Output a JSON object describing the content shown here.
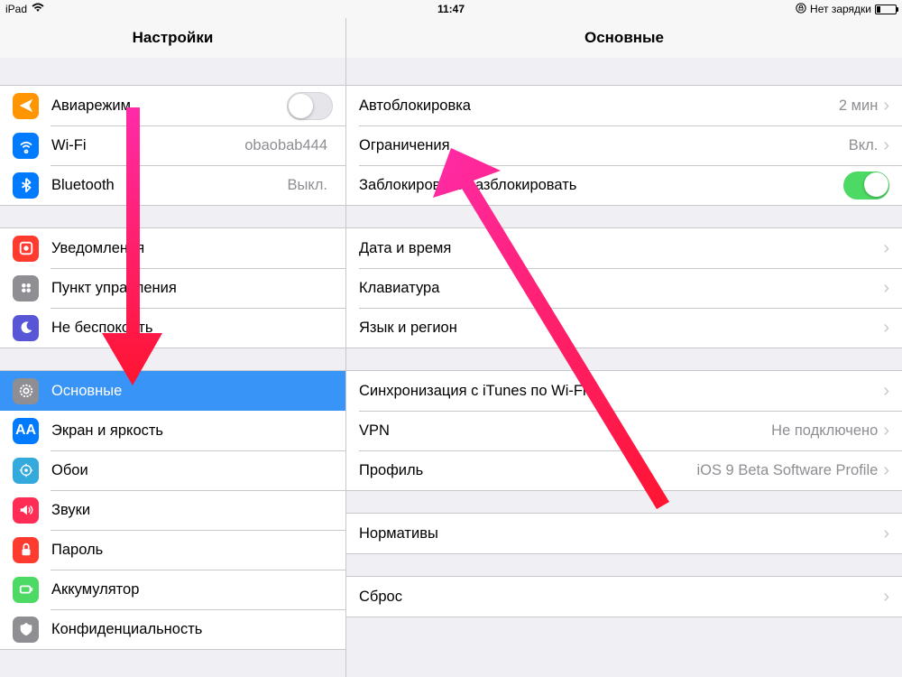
{
  "status": {
    "device": "iPad",
    "time": "11:47",
    "charging_text": "Нет зарядки"
  },
  "header": {
    "left_title": "Настройки",
    "right_title": "Основные"
  },
  "sidebar": {
    "group1": [
      {
        "id": "airplane",
        "label": "Авиарежим",
        "switch": "off"
      },
      {
        "id": "wifi",
        "label": "Wi-Fi",
        "value": "obaobab444"
      },
      {
        "id": "bluetooth",
        "label": "Bluetooth",
        "value": "Выкл."
      }
    ],
    "group2": [
      {
        "id": "notifications",
        "label": "Уведомления"
      },
      {
        "id": "controlcenter",
        "label": "Пункт управления"
      },
      {
        "id": "dnd",
        "label": "Не беспокоить"
      }
    ],
    "group3": [
      {
        "id": "general",
        "label": "Основные",
        "selected": true
      },
      {
        "id": "display",
        "label": "Экран и яркость"
      },
      {
        "id": "wallpaper",
        "label": "Обои"
      },
      {
        "id": "sounds",
        "label": "Звуки"
      },
      {
        "id": "passcode",
        "label": "Пароль"
      },
      {
        "id": "battery",
        "label": "Аккумулятор"
      },
      {
        "id": "privacy",
        "label": "Конфиденциальность"
      }
    ]
  },
  "detail": {
    "group1": [
      {
        "id": "autolock",
        "label": "Автоблокировка",
        "value": "2 мин"
      },
      {
        "id": "restrictions",
        "label": "Ограничения",
        "value": "Вкл."
      },
      {
        "id": "lockunlock",
        "label": "Заблокировать/разблокировать",
        "switch": "on"
      }
    ],
    "group2": [
      {
        "id": "datetime",
        "label": "Дата и время"
      },
      {
        "id": "keyboard",
        "label": "Клавиатура"
      },
      {
        "id": "language",
        "label": "Язык и регион"
      }
    ],
    "group3": [
      {
        "id": "itunes",
        "label": "Синхронизация с iTunes по Wi-Fi"
      },
      {
        "id": "vpn",
        "label": "VPN",
        "value": "Не подключено"
      },
      {
        "id": "profile",
        "label": "Профиль",
        "value": "iOS 9 Beta Software Profile"
      }
    ],
    "group4": [
      {
        "id": "regulatory",
        "label": "Нормативы"
      }
    ],
    "group5": [
      {
        "id": "reset",
        "label": "Сброс"
      }
    ]
  }
}
